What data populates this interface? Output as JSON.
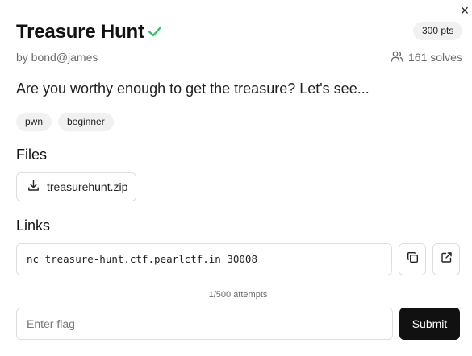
{
  "dialog": {
    "close_label": "×"
  },
  "challenge": {
    "title": "Treasure Hunt",
    "solved_icon": "check-icon",
    "points": "300 pts",
    "author": "by bond@james",
    "solves": "161 solves",
    "description": "Are you worthy enough to get the treasure? Let's see...",
    "tags": [
      "pwn",
      "beginner"
    ]
  },
  "files": {
    "heading": "Files",
    "items": [
      {
        "name": "treasurehunt.zip",
        "icon": "download-icon"
      }
    ]
  },
  "links": {
    "heading": "Links",
    "command": "nc treasure-hunt.ctf.pearlctf.in 30008",
    "copy_icon": "copy-icon",
    "open_icon": "external-link-icon"
  },
  "submission": {
    "attempts": "1/500 attempts",
    "placeholder": "Enter flag",
    "submit_label": "Submit"
  },
  "colors": {
    "accent_success": "#22c55e",
    "button_dark": "#111111",
    "badge_bg": "#f1f1f1",
    "muted_text": "#6b6b6b",
    "border": "#dedede"
  }
}
